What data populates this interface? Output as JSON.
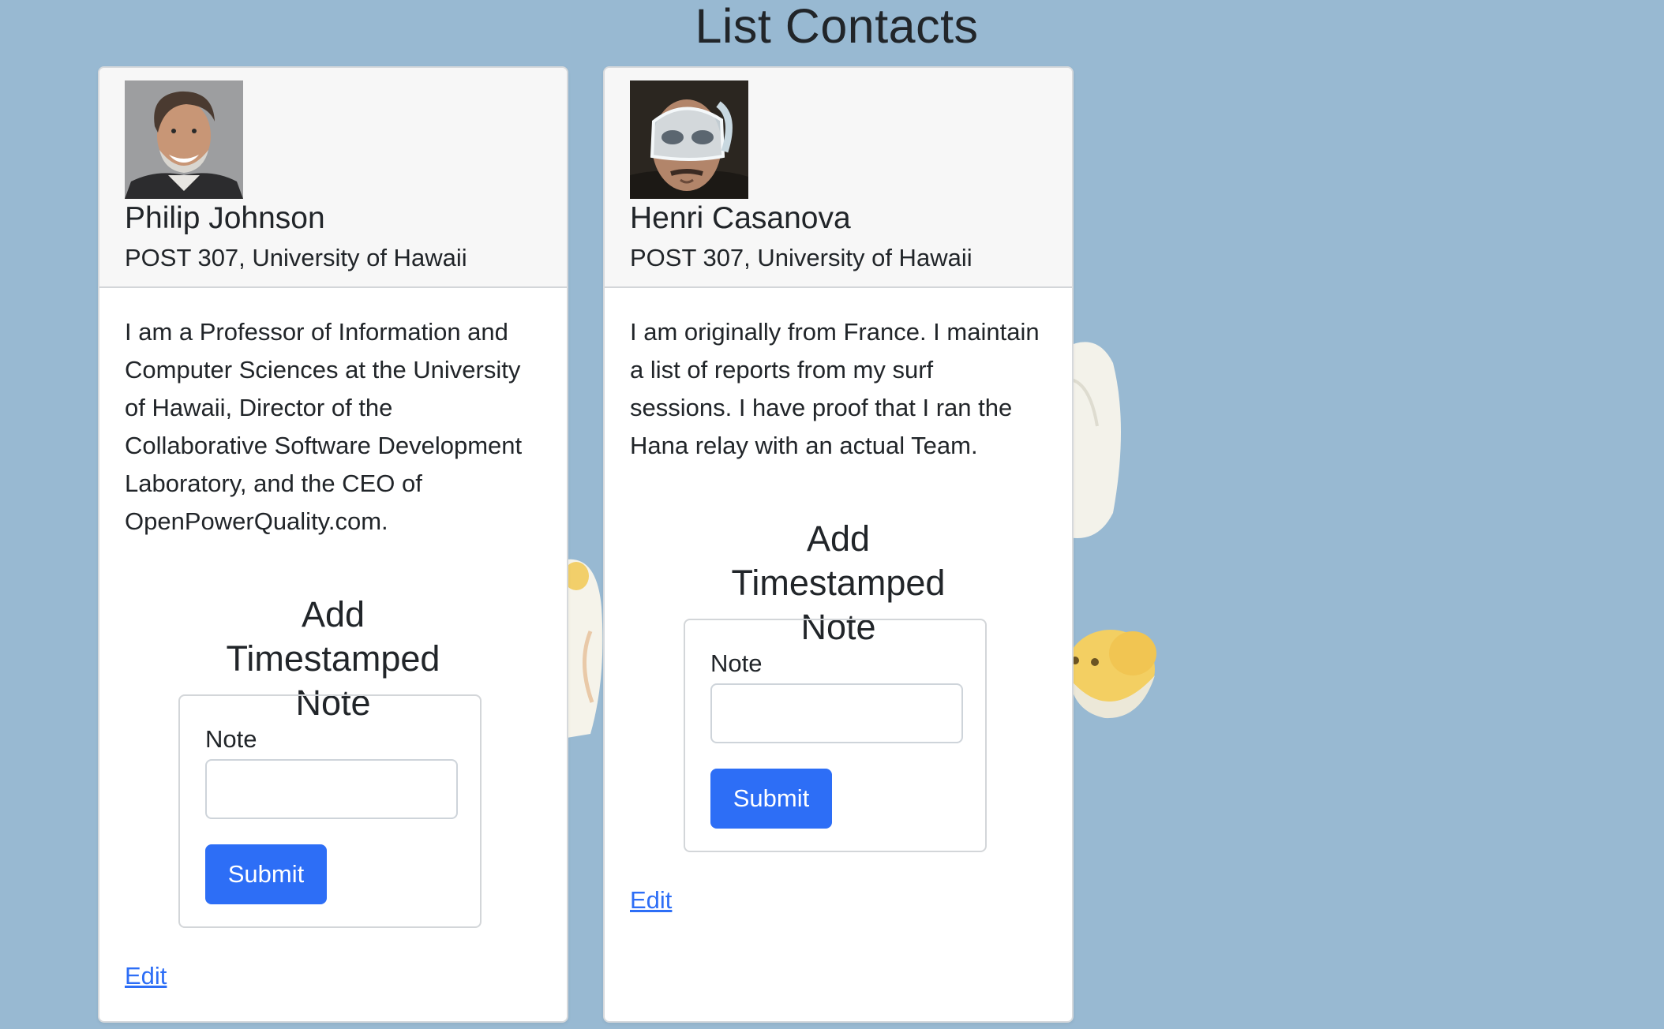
{
  "page": {
    "title": "List Contacts"
  },
  "contacts": [
    {
      "name": "Philip Johnson",
      "address": "POST 307, University of Hawaii",
      "bio": "I am a Professor of Information and Computer Sciences at the University of Hawaii, Director of the Collaborative Software Development Laboratory, and the CEO of OpenPowerQuality.com.",
      "note_form": {
        "title": "Add Timestamped Note",
        "label": "Note",
        "value": "",
        "submit_label": "Submit"
      },
      "edit_label": "Edit"
    },
    {
      "name": "Henri Casanova",
      "address": "POST 307, University of Hawaii",
      "bio": "I am originally from France. I maintain a list of reports from my surf sessions. I have proof that I ran the Hana relay with an actual Team.",
      "note_form": {
        "title": "Add Timestamped Note",
        "label": "Note",
        "value": "",
        "submit_label": "Submit"
      },
      "edit_label": "Edit"
    }
  ],
  "colors": {
    "background": "#98b9d2",
    "primary": "#2d6ef6",
    "card": "#ffffff",
    "card_header": "#f7f7f7"
  }
}
